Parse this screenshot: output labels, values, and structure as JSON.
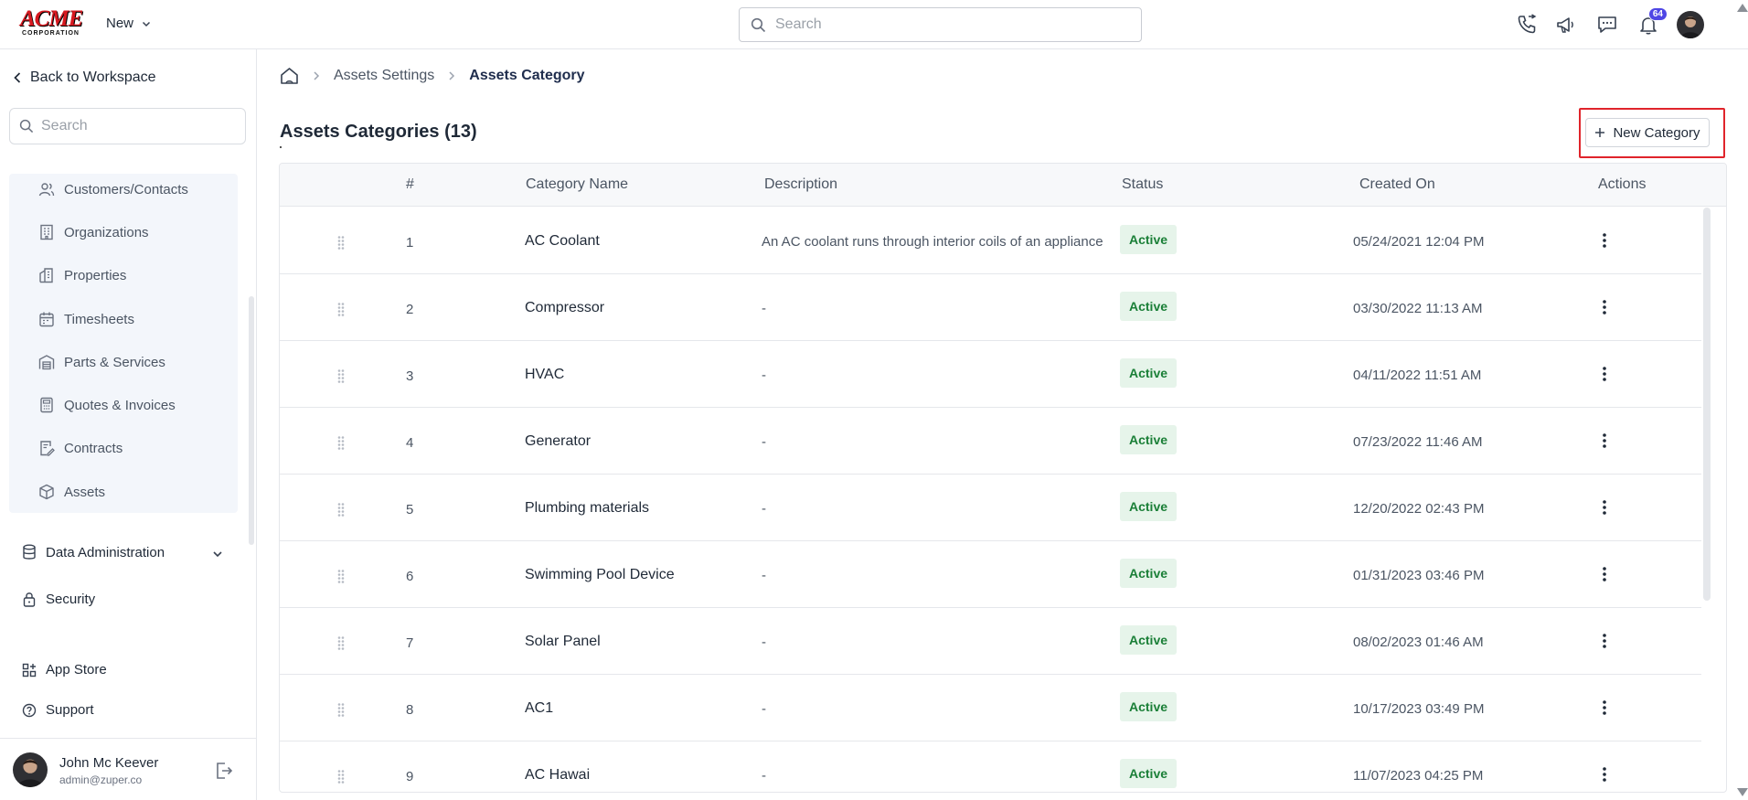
{
  "brand": {
    "logo_main": "ACME",
    "logo_sub": "CORPORATION"
  },
  "header": {
    "new_label": "New",
    "search_placeholder": "Search",
    "notification_count": "64",
    "icons": [
      "phone-icon",
      "megaphone-icon",
      "chat-icon",
      "bell-icon",
      "user-avatar"
    ]
  },
  "sidebar": {
    "back_label": "Back to Workspace",
    "search_placeholder": "Search",
    "items": [
      {
        "label": "Customers/Contacts",
        "icon": "users-icon"
      },
      {
        "label": "Organizations",
        "icon": "building-icon"
      },
      {
        "label": "Properties",
        "icon": "property-icon"
      },
      {
        "label": "Timesheets",
        "icon": "calendar-icon"
      },
      {
        "label": "Parts & Services",
        "icon": "warehouse-icon"
      },
      {
        "label": "Quotes & Invoices",
        "icon": "calculator-icon"
      },
      {
        "label": "Contracts",
        "icon": "contract-icon"
      },
      {
        "label": "Assets",
        "icon": "cube-icon"
      }
    ],
    "data_admin_label": "Data Administration",
    "security_label": "Security",
    "app_store_label": "App Store",
    "support_label": "Support",
    "user": {
      "name": "John Mc Keever",
      "email": "admin@zuper.co"
    }
  },
  "breadcrumb": {
    "settings": "Assets Settings",
    "current": "Assets Category"
  },
  "page": {
    "title": "Assets Categories (13)",
    "new_button_label": "New Category"
  },
  "table": {
    "columns": {
      "num": "#",
      "name": "Category Name",
      "description": "Description",
      "status": "Status",
      "created": "Created On",
      "actions": "Actions"
    },
    "rows": [
      {
        "num": "1",
        "name": "AC Coolant",
        "description": "An AC coolant runs through interior coils of an appliance",
        "status": "Active",
        "created": "05/24/2021 12:04 PM"
      },
      {
        "num": "2",
        "name": "Compressor",
        "description": "-",
        "status": "Active",
        "created": "03/30/2022 11:13 AM"
      },
      {
        "num": "3",
        "name": "HVAC",
        "description": "-",
        "status": "Active",
        "created": "04/11/2022 11:51 AM"
      },
      {
        "num": "4",
        "name": "Generator",
        "description": "-",
        "status": "Active",
        "created": "07/23/2022 11:46 AM"
      },
      {
        "num": "5",
        "name": "Plumbing materials",
        "description": "-",
        "status": "Active",
        "created": "12/20/2022 02:43 PM"
      },
      {
        "num": "6",
        "name": "Swimming Pool Device",
        "description": "-",
        "status": "Active",
        "created": "01/31/2023 03:46 PM"
      },
      {
        "num": "7",
        "name": "Solar Panel",
        "description": "-",
        "status": "Active",
        "created": "08/02/2023 01:46 AM"
      },
      {
        "num": "8",
        "name": "AC1",
        "description": "-",
        "status": "Active",
        "created": "10/17/2023 03:49 PM"
      },
      {
        "num": "9",
        "name": "AC Hawai",
        "description": "-",
        "status": "Active",
        "created": "11/07/2023 04:25 PM"
      }
    ]
  },
  "colors": {
    "accent": "#1f2d4d",
    "status_bg": "#e6f4ea",
    "status_text": "#1a7f37",
    "badge": "#4f46e5",
    "highlight": "#e0242b"
  }
}
